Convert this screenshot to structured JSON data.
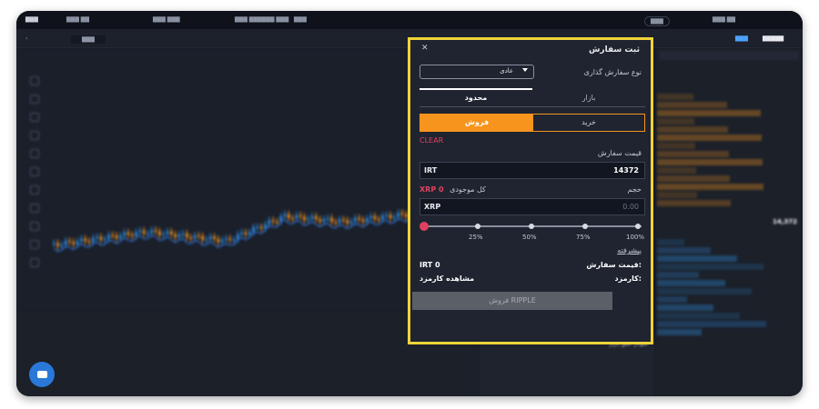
{
  "modal": {
    "title": "ثبت سفارش",
    "order_type_label": "نوع سفارش گذاری",
    "order_type_value": "عادی",
    "tabs": {
      "limited": "محدود",
      "market": "بازار"
    },
    "sell_label": "فروش",
    "buy_label": "خرید",
    "clear_label": "CLEAR",
    "price_label": "قیمت سفارش",
    "price_currency": "IRT",
    "price_value": "14372",
    "volume_label": "حجم",
    "balance_label": "کل موجودی",
    "balance_value": "XRP 0",
    "volume_currency": "XRP",
    "volume_placeholder": "0.00",
    "slider_fraction": 0,
    "slider_marks": [
      "25%",
      "50%",
      "75%",
      "100%"
    ],
    "advanced_label": "پیشرفته",
    "summary_price_label": "قیمت سفارش:",
    "summary_price_value": "IRT 0",
    "fee_label": "کارمزد:",
    "fee_link": "مشاهده کارمزد",
    "submit_label": "فروش RIPPLE",
    "accent_color": "#f7941d",
    "highlight_border": "#f0d43a",
    "danger_color": "#e0415e"
  },
  "header": {
    "pair_value": "14,372",
    "chart_title": "نمودار عمق بازار"
  }
}
